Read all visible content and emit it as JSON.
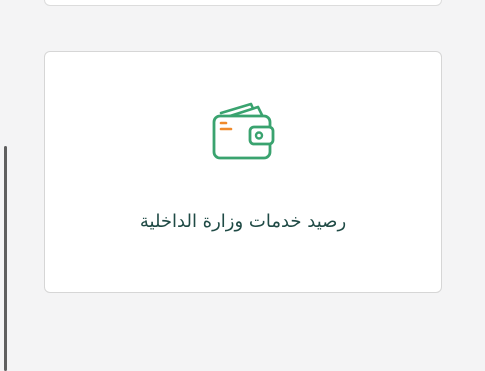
{
  "cards": [
    {
      "label": "رصيد خدمات وزارة الداخلية",
      "icon": "wallet-icon"
    }
  ],
  "colors": {
    "page_background": "#f4f4f5",
    "card_background": "#ffffff",
    "card_border": "#d6d6d6",
    "icon_green": "#3aa36f",
    "icon_accent": "#f08a2c",
    "label_text": "#1f4a45",
    "scrollbar": "#5f5f5f"
  }
}
